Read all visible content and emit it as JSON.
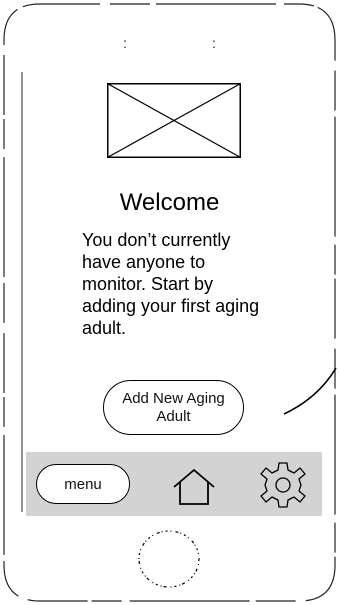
{
  "status_bar": {
    "left_glyph": ":",
    "right_glyph": ":"
  },
  "content": {
    "image_icon": "image-placeholder-icon",
    "title": "Welcome",
    "message": "You don’t currently have anyone to monitor. Start by adding your first aging adult."
  },
  "actions": {
    "add_button_label": "Add New Aging Adult"
  },
  "tabbar": {
    "menu_label": "menu",
    "home_icon": "home-icon",
    "settings_icon": "gear-icon"
  },
  "device": {
    "home_button_icon": "home-button-icon"
  },
  "colors": {
    "tabbar_background": "#d3d3d3",
    "stroke": "#000000",
    "background": "#ffffff"
  }
}
